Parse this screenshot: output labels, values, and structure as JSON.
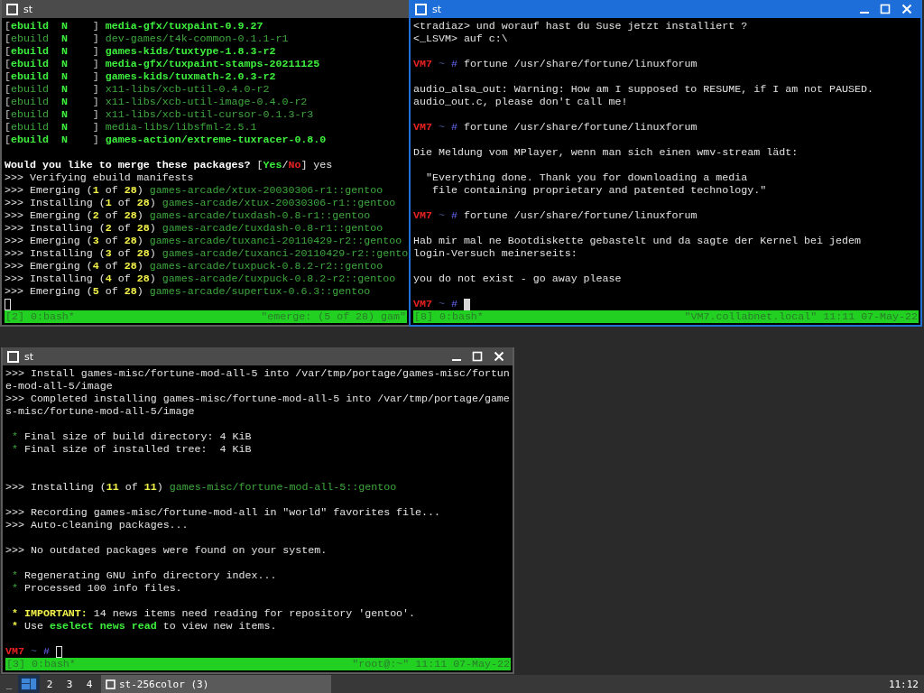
{
  "windows": [
    {
      "title": "st",
      "active": false,
      "title_buttons": false,
      "lines": [
        {
          "kind": "text",
          "segments": [
            {
              "text": "[",
              "kind": "grey"
            },
            {
              "text": "ebuild",
              "kind": "green_bold"
            },
            {
              "text": "  N",
              "kind": "green_bold"
            },
            {
              "text": "    ] ",
              "kind": "grey"
            },
            {
              "text": "media-gfx/tuxpaint-0.9.27",
              "kind": "green_bold"
            }
          ]
        },
        {
          "kind": "text",
          "segments": [
            {
              "text": "[",
              "kind": "grey"
            },
            {
              "text": "ebuild",
              "kind": "green"
            },
            {
              "text": "  N",
              "kind": "green_bold"
            },
            {
              "text": "    ] ",
              "kind": "grey"
            },
            {
              "text": "dev-games/t4k-common-0.1.1-r1",
              "kind": "green"
            }
          ]
        },
        {
          "kind": "text",
          "segments": [
            {
              "text": "[",
              "kind": "grey"
            },
            {
              "text": "ebuild",
              "kind": "green_bold"
            },
            {
              "text": "  N",
              "kind": "green_bold"
            },
            {
              "text": "    ] ",
              "kind": "grey"
            },
            {
              "text": "games-kids/tuxtype-1.8.3-r2",
              "kind": "green_bold"
            }
          ]
        },
        {
          "kind": "text",
          "segments": [
            {
              "text": "[",
              "kind": "grey"
            },
            {
              "text": "ebuild",
              "kind": "green_bold"
            },
            {
              "text": "  N",
              "kind": "green_bold"
            },
            {
              "text": "    ] ",
              "kind": "grey"
            },
            {
              "text": "media-gfx/tuxpaint-stamps-20211125",
              "kind": "green_bold"
            }
          ]
        },
        {
          "kind": "text",
          "segments": [
            {
              "text": "[",
              "kind": "grey"
            },
            {
              "text": "ebuild",
              "kind": "green_bold"
            },
            {
              "text": "  N",
              "kind": "green_bold"
            },
            {
              "text": "    ] ",
              "kind": "grey"
            },
            {
              "text": "games-kids/tuxmath-2.0.3-r2",
              "kind": "green_bold"
            }
          ]
        },
        {
          "kind": "text",
          "segments": [
            {
              "text": "[",
              "kind": "grey"
            },
            {
              "text": "ebuild",
              "kind": "green"
            },
            {
              "text": "  N",
              "kind": "green_bold"
            },
            {
              "text": "    ] ",
              "kind": "grey"
            },
            {
              "text": "x11-libs/xcb-util-0.4.0-r2",
              "kind": "green"
            }
          ]
        },
        {
          "kind": "text",
          "segments": [
            {
              "text": "[",
              "kind": "grey"
            },
            {
              "text": "ebuild",
              "kind": "green"
            },
            {
              "text": "  N",
              "kind": "green_bold"
            },
            {
              "text": "    ] ",
              "kind": "grey"
            },
            {
              "text": "x11-libs/xcb-util-image-0.4.0-r2",
              "kind": "green"
            }
          ]
        },
        {
          "kind": "text",
          "segments": [
            {
              "text": "[",
              "kind": "grey"
            },
            {
              "text": "ebuild",
              "kind": "green"
            },
            {
              "text": "  N",
              "kind": "green_bold"
            },
            {
              "text": "    ] ",
              "kind": "grey"
            },
            {
              "text": "x11-libs/xcb-util-cursor-0.1.3-r3",
              "kind": "green"
            }
          ]
        },
        {
          "kind": "text",
          "segments": [
            {
              "text": "[",
              "kind": "grey"
            },
            {
              "text": "ebuild",
              "kind": "green"
            },
            {
              "text": "  N",
              "kind": "green_bold"
            },
            {
              "text": "    ] ",
              "kind": "grey"
            },
            {
              "text": "media-libs/libsfml-2.5.1",
              "kind": "green"
            }
          ]
        },
        {
          "kind": "text",
          "segments": [
            {
              "text": "[",
              "kind": "grey"
            },
            {
              "text": "ebuild",
              "kind": "green_bold"
            },
            {
              "text": "  N",
              "kind": "green_bold"
            },
            {
              "text": "    ] ",
              "kind": "grey"
            },
            {
              "text": "games-action/extreme-tuxracer-0.8.0",
              "kind": "green_bold"
            }
          ]
        },
        {
          "kind": "blank"
        },
        {
          "kind": "text",
          "segments": [
            {
              "text": "Would you like to merge these packages? ",
              "kind": "bold"
            },
            {
              "text": "[",
              "kind": "plain"
            },
            {
              "text": "Yes",
              "kind": "green_bold"
            },
            {
              "text": "/",
              "kind": "plain"
            },
            {
              "text": "No",
              "kind": "red_bold"
            },
            {
              "text": "] yes",
              "kind": "plain"
            }
          ]
        },
        {
          "kind": "text",
          "segments": [
            {
              "text": ">>> Verifying ebuild manifests",
              "kind": "plain"
            }
          ]
        },
        {
          "kind": "text",
          "segments": [
            {
              "text": ">>> Emerging (",
              "kind": "plain"
            },
            {
              "text": "1",
              "kind": "yellow_bold"
            },
            {
              "text": " of ",
              "kind": "plain"
            },
            {
              "text": "28",
              "kind": "yellow_bold"
            },
            {
              "text": ") ",
              "kind": "plain"
            },
            {
              "text": "games-arcade/xtux-20030306-r1::gentoo",
              "kind": "green"
            }
          ]
        },
        {
          "kind": "text",
          "segments": [
            {
              "text": ">>> Installing (",
              "kind": "plain"
            },
            {
              "text": "1",
              "kind": "yellow_bold"
            },
            {
              "text": " of ",
              "kind": "plain"
            },
            {
              "text": "28",
              "kind": "yellow_bold"
            },
            {
              "text": ") ",
              "kind": "plain"
            },
            {
              "text": "games-arcade/xtux-20030306-r1::gentoo",
              "kind": "green"
            }
          ]
        },
        {
          "kind": "text",
          "segments": [
            {
              "text": ">>> Emerging (",
              "kind": "plain"
            },
            {
              "text": "2",
              "kind": "yellow_bold"
            },
            {
              "text": " of ",
              "kind": "plain"
            },
            {
              "text": "28",
              "kind": "yellow_bold"
            },
            {
              "text": ") ",
              "kind": "plain"
            },
            {
              "text": "games-arcade/tuxdash-0.8-r1::gentoo",
              "kind": "green"
            }
          ]
        },
        {
          "kind": "text",
          "segments": [
            {
              "text": ">>> Installing (",
              "kind": "plain"
            },
            {
              "text": "2",
              "kind": "yellow_bold"
            },
            {
              "text": " of ",
              "kind": "plain"
            },
            {
              "text": "28",
              "kind": "yellow_bold"
            },
            {
              "text": ") ",
              "kind": "plain"
            },
            {
              "text": "games-arcade/tuxdash-0.8-r1::gentoo",
              "kind": "green"
            }
          ]
        },
        {
          "kind": "text",
          "segments": [
            {
              "text": ">>> Emerging (",
              "kind": "plain"
            },
            {
              "text": "3",
              "kind": "yellow_bold"
            },
            {
              "text": " of ",
              "kind": "plain"
            },
            {
              "text": "28",
              "kind": "yellow_bold"
            },
            {
              "text": ") ",
              "kind": "plain"
            },
            {
              "text": "games-arcade/tuxanci-20110429-r2::gentoo",
              "kind": "green"
            }
          ]
        },
        {
          "kind": "text",
          "segments": [
            {
              "text": ">>> Installing (",
              "kind": "plain"
            },
            {
              "text": "3",
              "kind": "yellow_bold"
            },
            {
              "text": " of ",
              "kind": "plain"
            },
            {
              "text": "28",
              "kind": "yellow_bold"
            },
            {
              "text": ") ",
              "kind": "plain"
            },
            {
              "text": "games-arcade/tuxanci-20110429-r2::gento",
              "kind": "green"
            }
          ]
        },
        {
          "kind": "text",
          "segments": [
            {
              "text": ">>> Emerging (",
              "kind": "plain"
            },
            {
              "text": "4",
              "kind": "yellow_bold"
            },
            {
              "text": " of ",
              "kind": "plain"
            },
            {
              "text": "28",
              "kind": "yellow_bold"
            },
            {
              "text": ") ",
              "kind": "plain"
            },
            {
              "text": "games-arcade/tuxpuck-0.8.2-r2::gentoo",
              "kind": "green"
            }
          ]
        },
        {
          "kind": "text",
          "segments": [
            {
              "text": ">>> Installing (",
              "kind": "plain"
            },
            {
              "text": "4",
              "kind": "yellow_bold"
            },
            {
              "text": " of ",
              "kind": "plain"
            },
            {
              "text": "28",
              "kind": "yellow_bold"
            },
            {
              "text": ") ",
              "kind": "plain"
            },
            {
              "text": "games-arcade/tuxpuck-0.8.2-r2::gentoo",
              "kind": "green"
            }
          ]
        },
        {
          "kind": "text",
          "segments": [
            {
              "text": ">>> Emerging (",
              "kind": "plain"
            },
            {
              "text": "5",
              "kind": "yellow_bold"
            },
            {
              "text": " of ",
              "kind": "plain"
            },
            {
              "text": "28",
              "kind": "yellow_bold"
            },
            {
              "text": ") ",
              "kind": "plain"
            },
            {
              "text": "games-arcade/supertux-0.6.3::gentoo",
              "kind": "green"
            }
          ]
        },
        {
          "kind": "cursor"
        }
      ],
      "status_left": "[2] 0:bash*",
      "status_right": "\"emerge: (5 of 28) gam\""
    },
    {
      "title": "st",
      "active": true,
      "title_buttons": true,
      "lines": [
        {
          "kind": "text",
          "segments": [
            {
              "text": "<tradiaz> und worauf hast du Suse jetzt installiert ?",
              "kind": "plain"
            }
          ]
        },
        {
          "kind": "text",
          "segments": [
            {
              "text": "<_LSVM> auf c:\\",
              "kind": "plain"
            }
          ]
        },
        {
          "kind": "blank"
        },
        {
          "kind": "text",
          "segments": [
            {
              "text": "VM7",
              "kind": "red_bold"
            },
            {
              "text": " ~",
              "kind": "tilde"
            },
            {
              "text": " #",
              "kind": "hash"
            },
            {
              "text": " fortune /usr/share/fortune/linuxforum",
              "kind": "plain"
            }
          ]
        },
        {
          "kind": "blank"
        },
        {
          "kind": "text",
          "segments": [
            {
              "text": "audio_alsa_out: Warning: How am I supposed to RESUME, if I am not PAUSED.",
              "kind": "plain"
            }
          ]
        },
        {
          "kind": "text",
          "segments": [
            {
              "text": "audio_out.c, please don't call me!",
              "kind": "plain"
            }
          ]
        },
        {
          "kind": "blank"
        },
        {
          "kind": "text",
          "segments": [
            {
              "text": "VM7",
              "kind": "red_bold"
            },
            {
              "text": " ~",
              "kind": "tilde"
            },
            {
              "text": " #",
              "kind": "hash"
            },
            {
              "text": " fortune /usr/share/fortune/linuxforum",
              "kind": "plain"
            }
          ]
        },
        {
          "kind": "blank"
        },
        {
          "kind": "text",
          "segments": [
            {
              "text": "Die Meldung vom MPlayer, wenn man sich einen wmv-stream lädt:",
              "kind": "plain"
            }
          ]
        },
        {
          "kind": "blank"
        },
        {
          "kind": "text",
          "segments": [
            {
              "text": "  \"Everything done. Thank you for downloading a media",
              "kind": "plain"
            }
          ]
        },
        {
          "kind": "text",
          "segments": [
            {
              "text": "   file containing proprietary and patented technology.\"",
              "kind": "plain"
            }
          ]
        },
        {
          "kind": "blank"
        },
        {
          "kind": "text",
          "segments": [
            {
              "text": "VM7",
              "kind": "red_bold"
            },
            {
              "text": " ~",
              "kind": "tilde"
            },
            {
              "text": " #",
              "kind": "hash"
            },
            {
              "text": " fortune /usr/share/fortune/linuxforum",
              "kind": "plain"
            }
          ]
        },
        {
          "kind": "blank"
        },
        {
          "kind": "text",
          "segments": [
            {
              "text": "Hab mir mal ne Bootdiskette gebastelt und da sagte der Kernel bei jedem",
              "kind": "plain"
            }
          ]
        },
        {
          "kind": "text",
          "segments": [
            {
              "text": "login-Versuch meinerseits:",
              "kind": "plain"
            }
          ]
        },
        {
          "kind": "blank"
        },
        {
          "kind": "text",
          "segments": [
            {
              "text": "you do not exist - go away please",
              "kind": "plain"
            }
          ]
        },
        {
          "kind": "blank"
        },
        {
          "kind": "cursor",
          "segments": [
            {
              "text": "VM7",
              "kind": "red_bold"
            },
            {
              "text": " ~",
              "kind": "tilde"
            },
            {
              "text": " #",
              "kind": "hash"
            }
          ]
        }
      ],
      "status_left": "[8] 0:bash*",
      "status_right": "\"VM7.collabnet.local\" 11:11 07-May-22"
    },
    {
      "title": "st",
      "active": false,
      "title_buttons": true,
      "lines": [
        {
          "kind": "text",
          "segments": [
            {
              "text": ">>> Install games-misc/fortune-mod-all-5 into /var/tmp/portage/games-misc/fortun",
              "kind": "plain"
            }
          ]
        },
        {
          "kind": "text",
          "segments": [
            {
              "text": "e-mod-all-5/image",
              "kind": "plain"
            }
          ]
        },
        {
          "kind": "text",
          "segments": [
            {
              "text": ">>> Completed installing games-misc/fortune-mod-all-5 into /var/tmp/portage/game",
              "kind": "plain"
            }
          ]
        },
        {
          "kind": "text",
          "segments": [
            {
              "text": "s-misc/fortune-mod-all-5/image",
              "kind": "plain"
            }
          ]
        },
        {
          "kind": "blank"
        },
        {
          "kind": "text",
          "segments": [
            {
              "text": " *",
              "kind": "green"
            },
            {
              "text": " Final size of build directory: 4 KiB",
              "kind": "plain"
            }
          ]
        },
        {
          "kind": "text",
          "segments": [
            {
              "text": " *",
              "kind": "green"
            },
            {
              "text": " Final size of installed tree:  4 KiB",
              "kind": "plain"
            }
          ]
        },
        {
          "kind": "blank"
        },
        {
          "kind": "blank"
        },
        {
          "kind": "text",
          "segments": [
            {
              "text": ">>> Installing (",
              "kind": "plain"
            },
            {
              "text": "11",
              "kind": "yellow_bold"
            },
            {
              "text": " of ",
              "kind": "plain"
            },
            {
              "text": "11",
              "kind": "yellow_bold"
            },
            {
              "text": ") ",
              "kind": "plain"
            },
            {
              "text": "games-misc/fortune-mod-all-5::gentoo",
              "kind": "green"
            }
          ]
        },
        {
          "kind": "blank"
        },
        {
          "kind": "text",
          "segments": [
            {
              "text": ">>> Recording games-misc/fortune-mod-all in \"world\" favorites file...",
              "kind": "plain"
            }
          ]
        },
        {
          "kind": "text",
          "segments": [
            {
              "text": ">>> Auto-cleaning packages...",
              "kind": "plain"
            }
          ]
        },
        {
          "kind": "blank"
        },
        {
          "kind": "text",
          "segments": [
            {
              "text": ">>> No outdated packages were found on your system.",
              "kind": "plain"
            }
          ]
        },
        {
          "kind": "blank"
        },
        {
          "kind": "text",
          "segments": [
            {
              "text": " *",
              "kind": "green"
            },
            {
              "text": " Regenerating GNU info directory index...",
              "kind": "plain"
            }
          ]
        },
        {
          "kind": "text",
          "segments": [
            {
              "text": " *",
              "kind": "green"
            },
            {
              "text": " Processed 100 info files.",
              "kind": "plain"
            }
          ]
        },
        {
          "kind": "blank"
        },
        {
          "kind": "text",
          "segments": [
            {
              "text": " *",
              "kind": "yellow_bold"
            },
            {
              "text": " IMPORTANT:",
              "kind": "yellow_bold"
            },
            {
              "text": " 14 news items need reading for repository 'gentoo'.",
              "kind": "plain"
            }
          ]
        },
        {
          "kind": "text",
          "segments": [
            {
              "text": " *",
              "kind": "yellow_bold"
            },
            {
              "text": " Use ",
              "kind": "plain"
            },
            {
              "text": "eselect news read",
              "kind": "green_bold"
            },
            {
              "text": " to view new items.",
              "kind": "plain"
            }
          ]
        },
        {
          "kind": "blank"
        },
        {
          "kind": "cursor",
          "segments": [
            {
              "text": "VM7",
              "kind": "red_bold"
            },
            {
              "text": " ~",
              "kind": "tilde"
            },
            {
              "text": " #",
              "kind": "hash"
            }
          ]
        }
      ],
      "status_left": "[3] 0:bash*",
      "status_right": "\"root@:~\" 11:11 07-May-22"
    }
  ],
  "taskbar": {
    "menu_glyph": "_",
    "workspaces": [
      {
        "selected": true
      },
      {
        "label": "2",
        "selected": false
      },
      {
        "label": "3",
        "selected": false
      },
      {
        "label": "4",
        "selected": false
      }
    ],
    "task": "st-256color (3)",
    "clock": "11:12"
  }
}
